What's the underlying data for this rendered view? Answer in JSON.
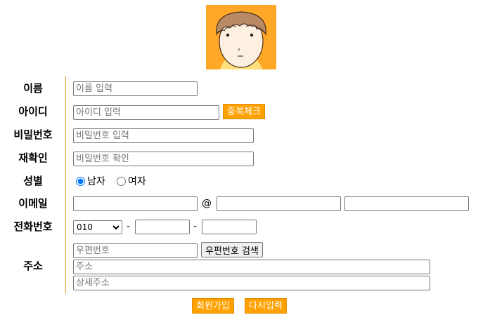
{
  "form": {
    "labels": {
      "name": "이름",
      "id": "아이디",
      "password": "비밀번호",
      "confirm": "재확인",
      "gender": "성별",
      "email": "이메일",
      "phone": "전화번호",
      "address": "주소"
    },
    "placeholders": {
      "name": "이름 입력",
      "id": "아이디 입력",
      "password": "비밀번호 입력",
      "confirm": "비밀번호 확인",
      "zipcode": "우편번호",
      "address": "주소",
      "address_detail": "상세주소"
    },
    "buttons": {
      "dup_check": "중복체크",
      "zip_search": "우편번호 검색",
      "signup": "회원가입",
      "reset": "다시입력"
    },
    "gender": {
      "male": "남자",
      "female": "여자",
      "selected": "male"
    },
    "email": {
      "at": "@"
    },
    "phone": {
      "prefix_selected": "010",
      "dash": "-"
    }
  },
  "colors": {
    "accent": "#ffa100",
    "avatar_bg": "#ffa726",
    "divider": "#f0a020"
  },
  "icons": {
    "avatar": "cartoon-boy-avatar"
  }
}
